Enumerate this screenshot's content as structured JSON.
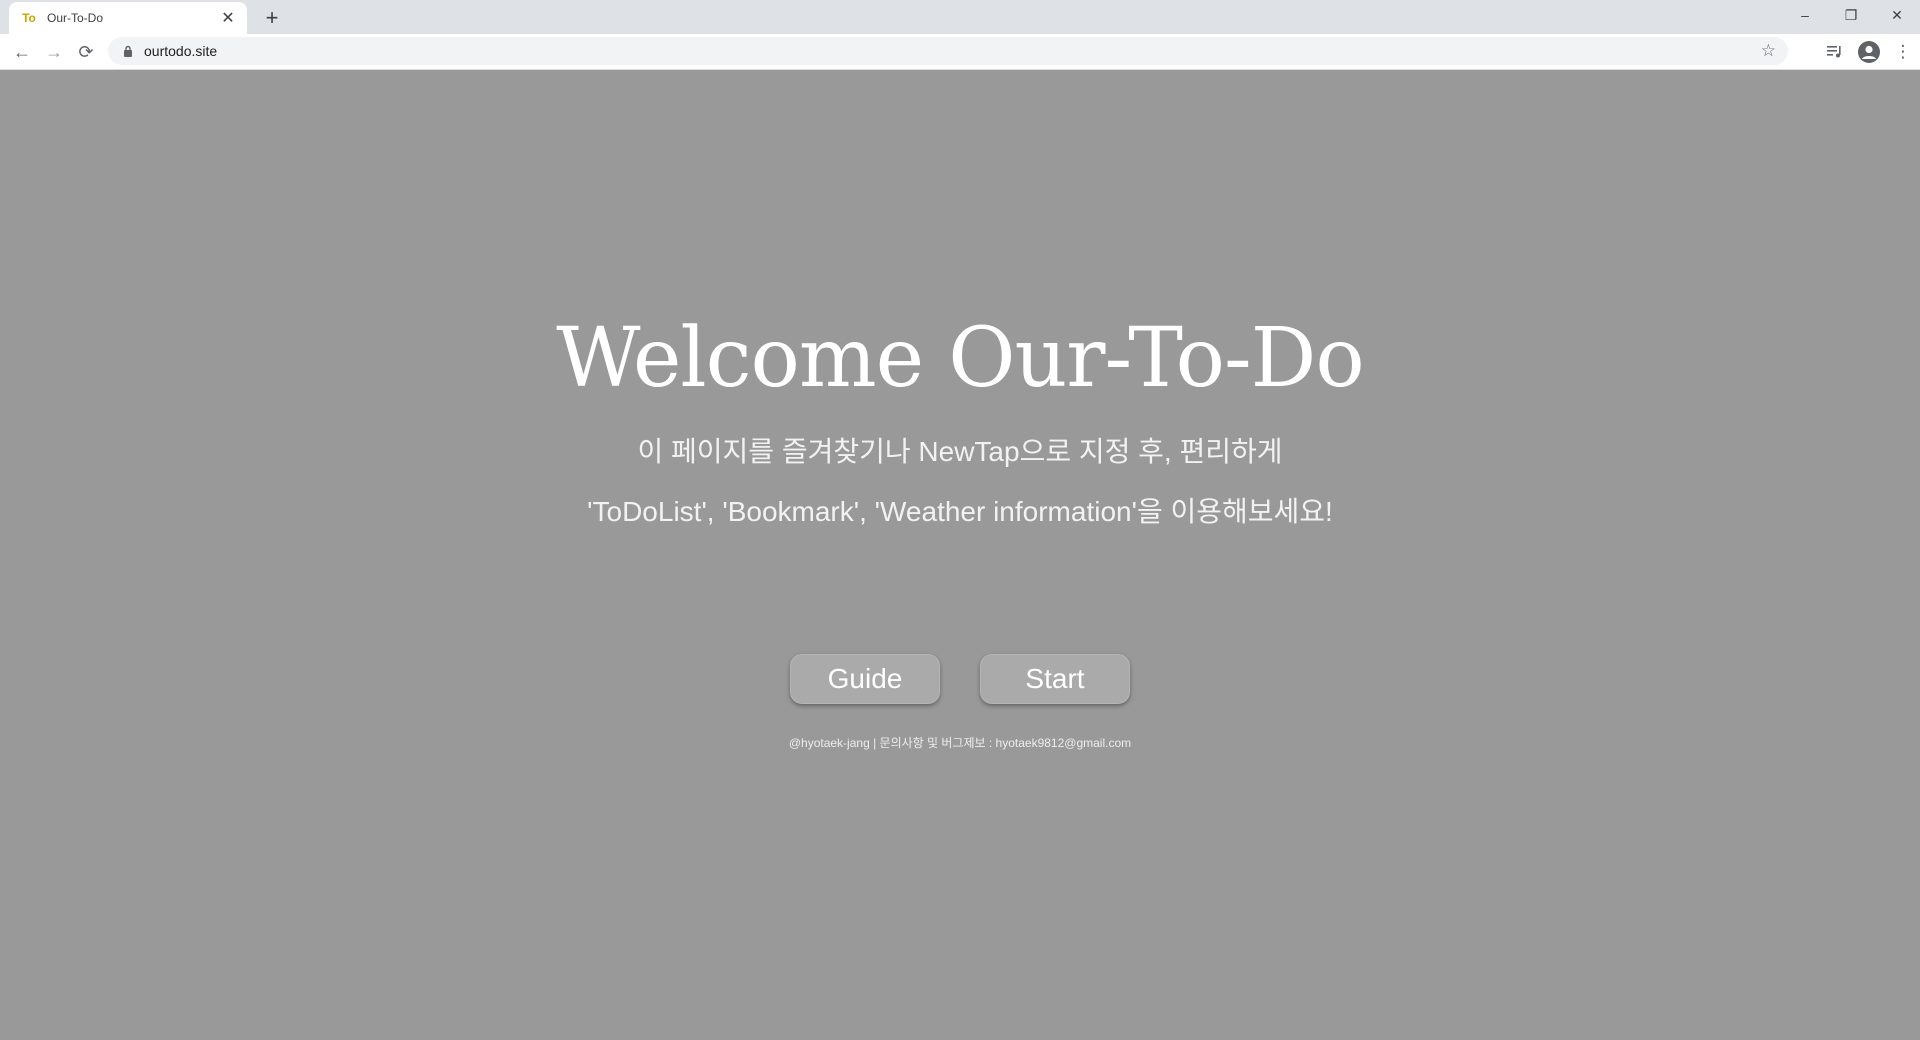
{
  "browser": {
    "tab": {
      "title": "Our-To-Do",
      "favicon": "To"
    },
    "new_tab_label": "+",
    "address": {
      "url": "ourtodo.site"
    },
    "window_controls": {
      "minimize": "–",
      "restore": "❐",
      "close": "✕"
    },
    "nav": {
      "back": "←",
      "forward": "→",
      "reload": "⟳"
    }
  },
  "page": {
    "title": "Welcome Our-To-Do",
    "line1": "이 페이지를 즐겨찾기나 NewTap으로 지정 후, 편리하게",
    "line2": "'ToDoList', 'Bookmark', 'Weather information'을 이용해보세요!",
    "buttons": {
      "guide": "Guide",
      "start": "Start"
    },
    "footer": "@hyotaek-jang | 문의사항 및 버그제보 : hyotaek9812@gmail.com"
  },
  "colors": {
    "background": "#999999",
    "button": "#aaaaaa",
    "text": "#ffffff"
  }
}
